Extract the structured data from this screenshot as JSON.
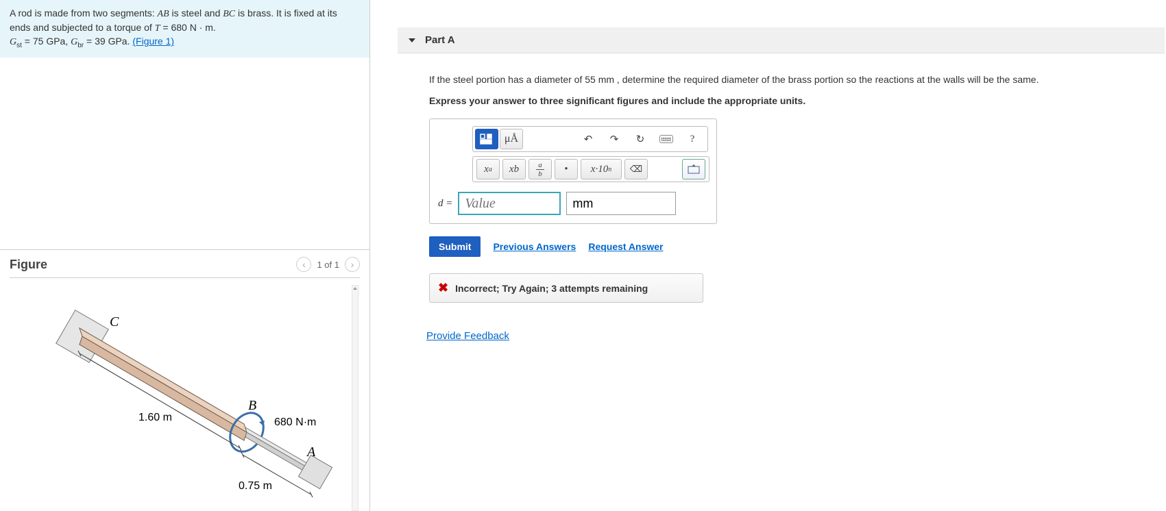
{
  "problem": {
    "line1_pre": "A rod is made from two segments: ",
    "AB": "AB",
    "line1_mid": " is steel and ",
    "BC": "BC",
    "line1_post": " is brass. It is fixed at its ends and subjected to a torque of ",
    "T_label": "T",
    "T_value": " = 680 N · m.",
    "Gst_label": "G",
    "Gst_sub": "st",
    "Gst_val": " = 75 GPa, ",
    "Gbr_label": "G",
    "Gbr_sub": "br",
    "Gbr_val": " = 39 GPa. ",
    "figure_link": "(Figure 1)"
  },
  "figure": {
    "title": "Figure",
    "nav_text": "1 of 1",
    "labels": {
      "C": "C",
      "B": "B",
      "A": "A",
      "len_bc": "1.60 m",
      "len_ab": "0.75 m",
      "torque": "680 N·m"
    }
  },
  "part": {
    "title": "Part A",
    "question_pre": "If the steel portion has a diameter of 55 ",
    "question_unit": "mm",
    "question_post": " , determine the required diameter of the brass portion so the reactions at the walls will be the same.",
    "instruction": "Express your answer to three significant figures and include the appropriate units.",
    "toolbar1": {
      "templates": "templates",
      "muA": "μÅ",
      "undo": "undo",
      "redo": "redo",
      "reset": "reset",
      "keyboard": "keyboard",
      "help": "?"
    },
    "toolbar2": {
      "xa": "x",
      "xa_sup": "a",
      "xb": "x",
      "xb_sub": "b",
      "frac_a": "a",
      "frac_b": "b",
      "dot": "•",
      "sci": "x·10",
      "sci_sup": "n",
      "backspace": "⌫",
      "kbd2": "keyboard"
    },
    "d_label": "d = ",
    "value_placeholder": "Value",
    "unit_value": "mm",
    "submit": "Submit",
    "previous": "Previous Answers",
    "request": "Request Answer",
    "feedback": "Incorrect; Try Again; 3 attempts remaining"
  },
  "provide_feedback": "Provide Feedback"
}
